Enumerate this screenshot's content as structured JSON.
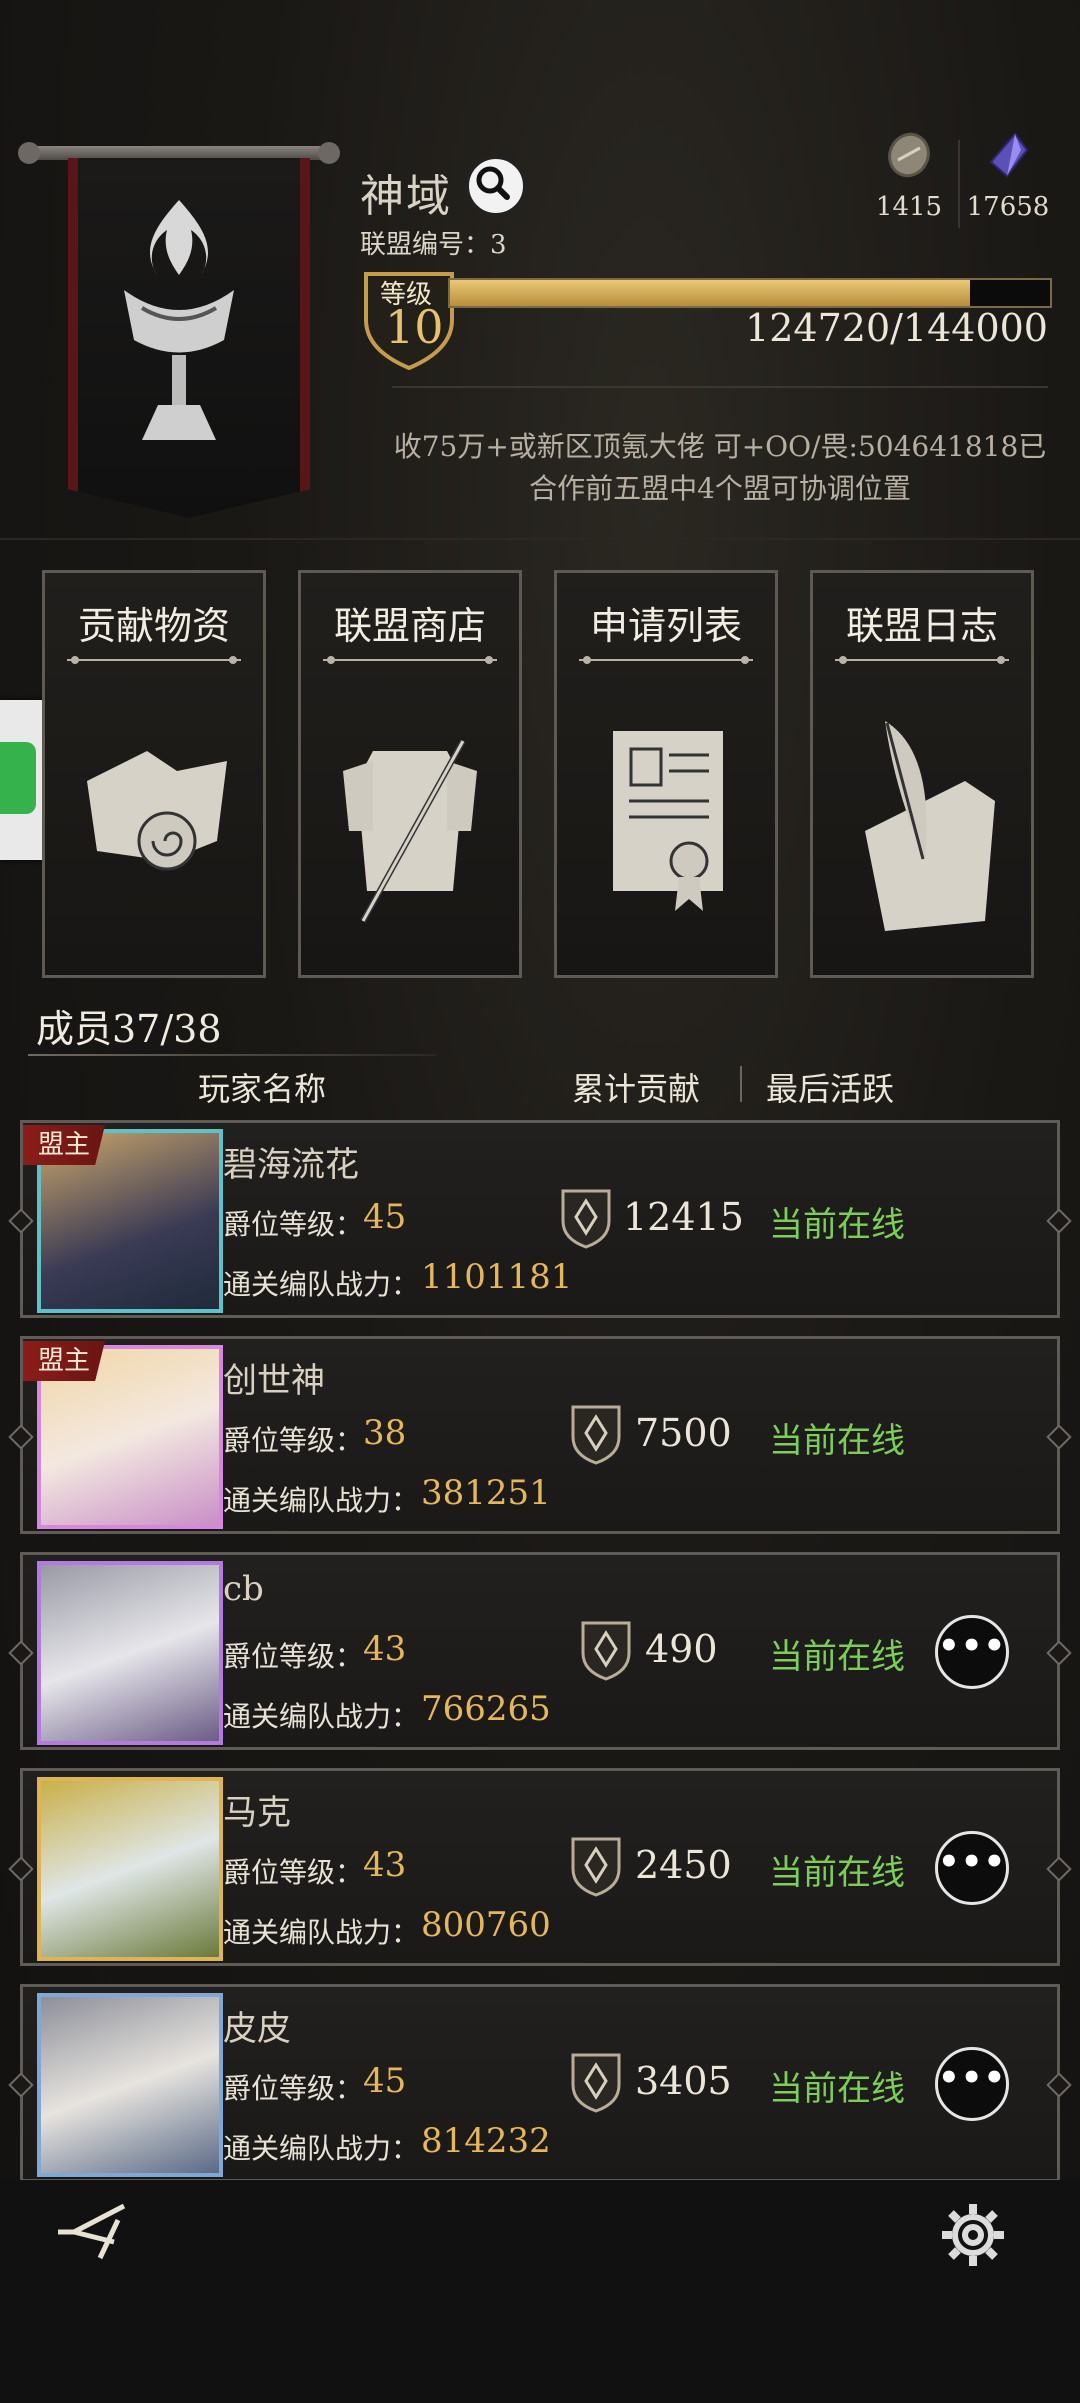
{
  "header": {
    "guild_name": "神域",
    "guild_id_label": "联盟编号：3",
    "level_label": "等级",
    "level": "10",
    "exp_text": "124720/144000",
    "exp_fraction": 0.866,
    "notice_line1": "收75万+或新区顶氪大佬 可+OO/畏:504641818已",
    "notice_line2": "合作前五盟中4个盟可协调位置"
  },
  "resources": [
    {
      "icon": "coin-icon",
      "value": "1415"
    },
    {
      "icon": "crystal-icon",
      "value": "17658"
    }
  ],
  "features": [
    {
      "label": "贡献物资",
      "icon": "supplies-icon"
    },
    {
      "label": "联盟商店",
      "icon": "armor-shop-icon"
    },
    {
      "label": "申请列表",
      "icon": "application-scroll-icon"
    },
    {
      "label": "联盟日志",
      "icon": "quill-log-icon"
    }
  ],
  "members": {
    "title": "成员37/38",
    "col_name": "玩家名称",
    "col_contrib": "累计贡献",
    "col_active": "最后活跃",
    "rank_label": "爵位等级：",
    "power_label": "通关编队战力：",
    "rows": [
      {
        "role": "盟主",
        "name": "碧海流花",
        "rank": "45",
        "power": "1101181",
        "contrib": "12415",
        "status": "当前在线",
        "has_more": false
      },
      {
        "role": "盟主",
        "name": "创世神",
        "rank": "38",
        "power": "381251",
        "contrib": "7500",
        "status": "当前在线",
        "has_more": false
      },
      {
        "role": "",
        "name": "cb",
        "rank": "43",
        "power": "766265",
        "contrib": "490",
        "status": "当前在线",
        "has_more": true
      },
      {
        "role": "",
        "name": "马克",
        "rank": "43",
        "power": "800760",
        "contrib": "2450",
        "status": "当前在线",
        "has_more": true
      },
      {
        "role": "",
        "name": "皮皮",
        "rank": "45",
        "power": "814232",
        "contrib": "3405",
        "status": "当前在线",
        "has_more": true
      }
    ],
    "more_glyph": "•••"
  },
  "colors": {
    "accent_gold": "#e6b75a",
    "online_green": "#7bcf56",
    "leader_red": "#8b1d1a"
  }
}
